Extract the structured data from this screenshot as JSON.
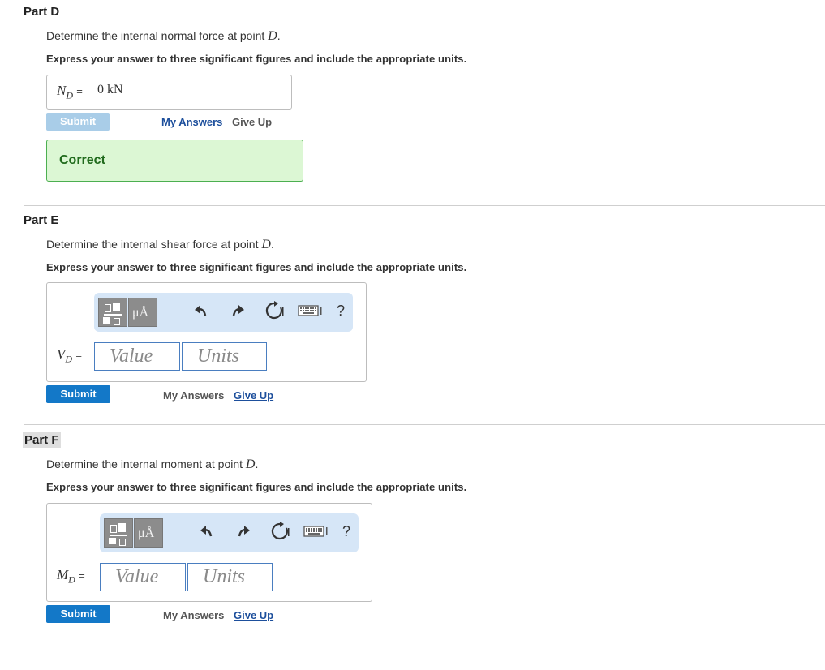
{
  "partD": {
    "title": "Part D",
    "prompt": "Determine the internal normal force at point",
    "point": "D",
    "instruction": "Express your answer to three significant figures and include the appropriate units.",
    "var_main": "N",
    "var_sub": "D",
    "equals": "=",
    "answer": "0 kN",
    "submit": "Submit",
    "my_answers": "My Answers",
    "give_up": "Give Up",
    "feedback": "Correct"
  },
  "partE": {
    "title": "Part E",
    "prompt": "Determine the internal shear force at point",
    "point": "D",
    "instruction": "Express your answer to three significant figures and include the appropriate units.",
    "var_main": "V",
    "var_sub": "D",
    "equals": "=",
    "value_placeholder": "Value",
    "units_placeholder": "Units",
    "submit": "Submit",
    "my_answers": "My Answers",
    "give_up": "Give Up"
  },
  "partF": {
    "title": "Part F",
    "prompt": "Determine the internal moment at point",
    "point": "D",
    "instruction": "Express your answer to three significant figures and include the appropriate units.",
    "var_main": "M",
    "var_sub": "D",
    "equals": "=",
    "value_placeholder": "Value",
    "units_placeholder": "Units",
    "submit": "Submit",
    "my_answers": "My Answers",
    "give_up": "Give Up"
  },
  "toolbar": {
    "units_button": "μÅ",
    "help": "?",
    "icons": [
      "templates-icon",
      "units-icon",
      "undo-icon",
      "redo-icon",
      "reset-icon",
      "keyboard-icon",
      "help-icon"
    ]
  },
  "colors": {
    "submit_active": "#1378c8",
    "submit_disabled": "#a9cde8",
    "correct_bg": "#dcf7d4",
    "correct_border": "#4caf50",
    "toolbar_bg": "#d6e6f7",
    "link": "#1d4f9c"
  }
}
